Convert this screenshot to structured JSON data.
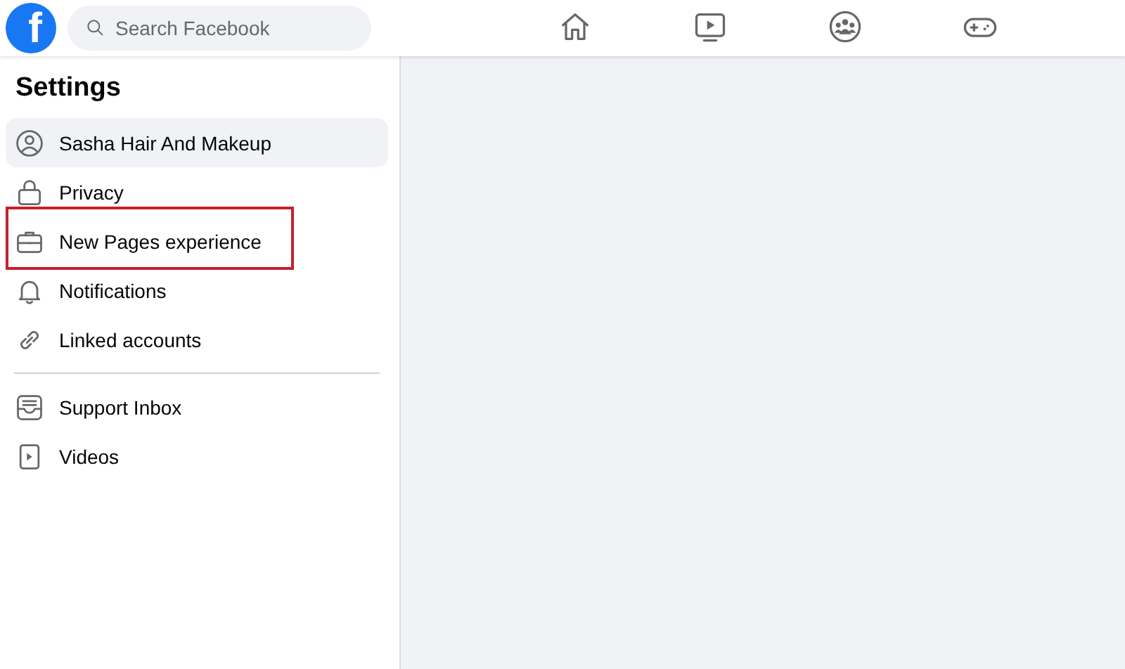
{
  "topbar": {
    "logo": "f",
    "search": {
      "placeholder": "Search Facebook"
    },
    "nav": [
      {
        "selected": false
      },
      {
        "selected": false
      },
      {
        "selected": false
      },
      {
        "selected": false
      }
    ]
  },
  "sidebar": {
    "title": "Settings",
    "groups": [
      {
        "items": [
          {
            "label": "Sasha Hair And Makeup",
            "selected": true,
            "highlighted": false
          },
          {
            "label": "Privacy",
            "selected": false,
            "highlighted": false
          },
          {
            "label": "New Pages experience",
            "selected": false,
            "highlighted": true
          },
          {
            "label": "Notifications",
            "selected": false,
            "highlighted": false
          },
          {
            "label": "Linked accounts",
            "selected": false,
            "highlighted": false
          }
        ]
      },
      {
        "items": [
          {
            "label": "Support Inbox",
            "selected": false,
            "highlighted": false
          },
          {
            "label": "Videos",
            "selected": false,
            "highlighted": false
          }
        ]
      }
    ]
  }
}
